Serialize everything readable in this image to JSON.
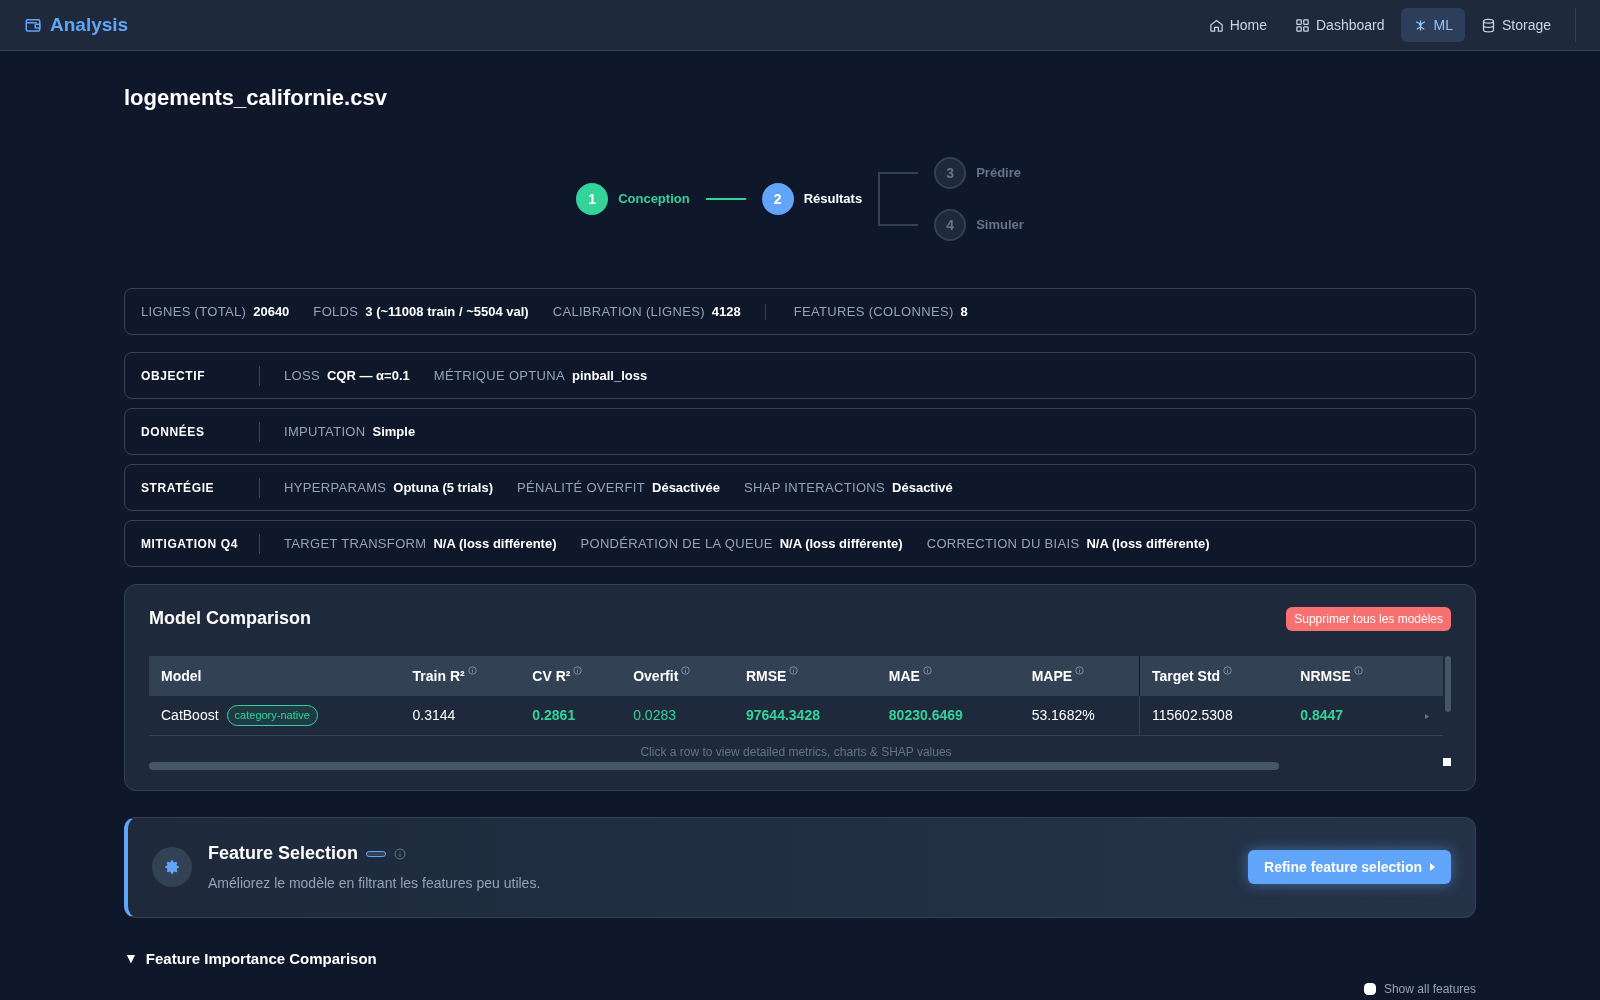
{
  "app": {
    "title": "Analysis"
  },
  "nav": [
    {
      "label": "Home",
      "selected": false
    },
    {
      "label": "Dashboard",
      "selected": false
    },
    {
      "label": "ML",
      "selected": true
    },
    {
      "label": "Storage",
      "selected": false
    }
  ],
  "page_title": "logements_californie.csv",
  "steps": [
    {
      "number": "1",
      "label": "Conception",
      "completed": true,
      "selected": false
    },
    {
      "number": "2",
      "label": "Résultats",
      "completed": false,
      "selected": true
    },
    {
      "number": "3",
      "label": "Prédire",
      "completed": false,
      "selected": false
    },
    {
      "number": "4",
      "label": "Simuler",
      "completed": false,
      "selected": false
    }
  ],
  "summary": {
    "groups": [
      {
        "items": [
          {
            "label": "LIGNES (TOTAL)",
            "value": "20640"
          },
          {
            "label": "FOLDS",
            "value": "3 (~11008 train / ~5504 val)"
          },
          {
            "label": "CALIBRATION (LIGNES)",
            "value": "4128"
          }
        ]
      },
      {
        "items": [
          {
            "label": "FEATURES (COLONNES)",
            "value": "8"
          }
        ]
      }
    ]
  },
  "sections": [
    {
      "title": "OBJECTIF",
      "items": [
        {
          "label": "LOSS",
          "value": "CQR — α=0.1"
        },
        {
          "label": "MÉTRIQUE OPTUNA",
          "value": "pinball_loss"
        }
      ]
    },
    {
      "title": "DONNÉES",
      "items": [
        {
          "label": "IMPUTATION",
          "value": "Simple"
        }
      ]
    },
    {
      "title": "STRATÉGIE",
      "items": [
        {
          "label": "HYPERPARAMS",
          "value": "Optuna (5 trials)"
        },
        {
          "label": "PÉNALITÉ OVERFIT",
          "value": "Désactivée"
        },
        {
          "label": "SHAP INTERACTIONS",
          "value": "Désactivé"
        }
      ]
    },
    {
      "title": "MITIGATION Q4",
      "items": [
        {
          "label": "TARGET TRANSFORM",
          "value": "N/A (loss différente)"
        },
        {
          "label": "PONDÉRATION DE LA QUEUE",
          "value": "N/A (loss différente)"
        },
        {
          "label": "CORRECTION DU BIAIS",
          "value": "N/A (loss différente)"
        }
      ]
    }
  ],
  "model_comparison": {
    "title": "Model Comparison",
    "delete_button": "Supprimer tous les modèles",
    "columns": [
      {
        "label": "Model",
        "info": false
      },
      {
        "label": "Train R²",
        "info": true
      },
      {
        "label": "CV R²",
        "info": true
      },
      {
        "label": "Overfit",
        "info": true
      },
      {
        "label": "RMSE",
        "info": true
      },
      {
        "label": "MAE",
        "info": true
      },
      {
        "label": "MAPE",
        "info": true
      },
      {
        "label": "Target Std",
        "info": true
      },
      {
        "label": "NRMSE",
        "info": true
      }
    ],
    "rows": [
      {
        "selected": false,
        "cells": [
          {
            "value": "CatBoost",
            "tag": "category-native",
            "kind": "plain"
          },
          {
            "value": "0.3144",
            "kind": "plain"
          },
          {
            "value": "0.2861",
            "kind": "good-bold"
          },
          {
            "value": "0.0283",
            "kind": "good"
          },
          {
            "value": "97644.3428",
            "kind": "good-bold"
          },
          {
            "value": "80230.6469",
            "kind": "good-bold"
          },
          {
            "value": "53.1682%",
            "kind": "plain"
          },
          {
            "value": "115602.5308",
            "kind": "plain"
          },
          {
            "value": "0.8447",
            "kind": "good-bold"
          }
        ]
      }
    ],
    "hint": "Click a row to view detailed metrics, charts & SHAP values"
  },
  "feature_selection": {
    "title": "Feature Selection",
    "description": "Améliorez le modèle en filtrant les features peu utiles.",
    "button": "Refine feature selection"
  },
  "feature_importance": {
    "title": "Feature Importance Comparison",
    "expanded": true,
    "toggle": "▼",
    "show_all": {
      "label": "Show all features",
      "checked": false
    }
  }
}
